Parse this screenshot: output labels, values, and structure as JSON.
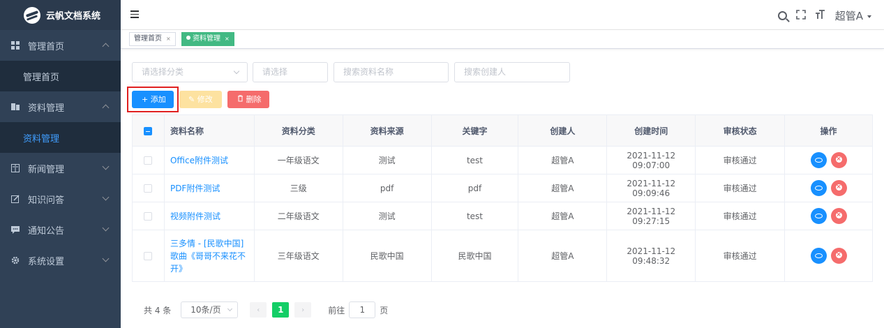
{
  "app": {
    "name": "云帆文档系统"
  },
  "sidebar": {
    "items": [
      {
        "label": "管理首页",
        "icon": "grid-icon",
        "expanded": true,
        "children": [
          {
            "label": "管理首页",
            "active": false
          }
        ]
      },
      {
        "label": "资料管理",
        "icon": "book-icon",
        "expanded": true,
        "children": [
          {
            "label": "资料管理",
            "active": true
          }
        ]
      },
      {
        "label": "新闻管理",
        "icon": "news-icon",
        "expanded": false
      },
      {
        "label": "知识问答",
        "icon": "edit-icon",
        "expanded": false
      },
      {
        "label": "通知公告",
        "icon": "message-icon",
        "expanded": false
      },
      {
        "label": "系统设置",
        "icon": "gear-icon",
        "expanded": false
      }
    ]
  },
  "header": {
    "user": "超管A"
  },
  "tags": [
    {
      "label": "管理首页",
      "active": false,
      "close": "×"
    },
    {
      "label": "资料管理",
      "active": true,
      "close": "×"
    }
  ],
  "filters": {
    "category_placeholder": "请选择分类",
    "select_placeholder": "请选择",
    "name_placeholder": "搜索资料名称",
    "creator_placeholder": "搜索创建人"
  },
  "toolbar": {
    "add_label": "添加",
    "edit_label": "修改",
    "delete_label": "删除"
  },
  "table": {
    "columns": [
      "资料名称",
      "资料分类",
      "资料来源",
      "关键字",
      "创建人",
      "创建时间",
      "审核状态",
      "操作"
    ],
    "rows": [
      {
        "name": "Office附件测试",
        "category": "一年级语文",
        "source": "测试",
        "keyword": "test",
        "creator": "超管A",
        "created": "2021-11-12 09:07:00",
        "status": "审核通过"
      },
      {
        "name": "PDF附件测试",
        "category": "三级",
        "source": "pdf",
        "keyword": "pdf",
        "creator": "超管A",
        "created": "2021-11-12 09:09:46",
        "status": "审核通过"
      },
      {
        "name": "视频附件测试",
        "category": "二年级语文",
        "source": "测试",
        "keyword": "test",
        "creator": "超管A",
        "created": "2021-11-12 09:27:15",
        "status": "审核通过"
      },
      {
        "name": "三多情 - [民歌中国]歌曲《哥哥不来花不开》",
        "category": "三年级语文",
        "source": "民歌中国",
        "keyword": "民歌中国",
        "creator": "超管A",
        "created": "2021-11-12 09:48:32",
        "status": "审核通过"
      }
    ]
  },
  "pagination": {
    "total_label": "共 4 条",
    "page_size": "10条/页",
    "current_page": "1",
    "goto_label": "前往",
    "goto_value": "1",
    "page_suffix": "页"
  },
  "colors": {
    "sidebar_bg": "#304156",
    "primary": "#1890ff",
    "success": "#13ce66",
    "danger": "#f56c6c",
    "tag_active": "#42b983"
  }
}
